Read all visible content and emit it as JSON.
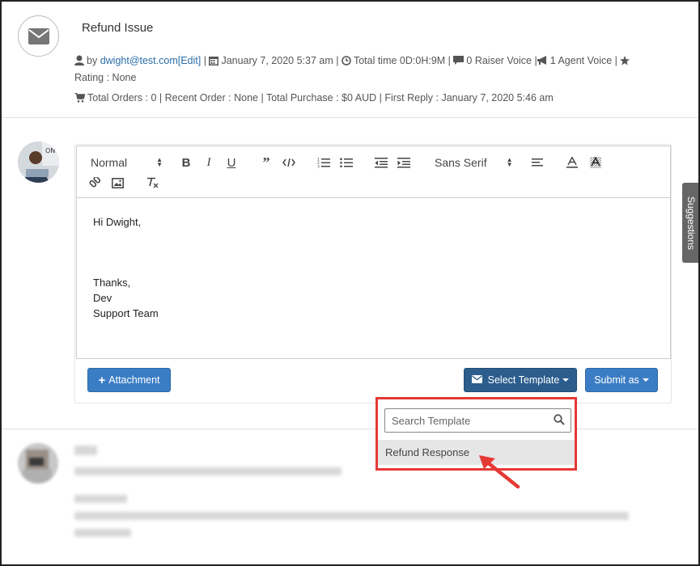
{
  "ticket": {
    "title": "Refund Issue",
    "by_prefix": "by",
    "author_email": "dwight@test.com",
    "edit_label": "[Edit]",
    "date": "January 7, 2020 5:37 am",
    "total_time": "Total time 0D:0H:9M",
    "raiser_voice": "0 Raiser Voice",
    "agent_voice": "1 Agent Voice",
    "rating": "Rating : None",
    "stats": "Total Orders : 0 | Recent Order : None | Total Purchase : $0 AUD | First Reply : January 7, 2020 5:46 am"
  },
  "toolbar": {
    "format_select": "Normal",
    "font_select": "Sans Serif"
  },
  "editor": {
    "line1": "Hi Dwight,",
    "line2": "Thanks,",
    "line3": "Dev",
    "line4": "Support Team"
  },
  "actions": {
    "attachment_label": "Attachment",
    "select_template_label": "Select Template",
    "submit_label": "Submit as"
  },
  "dropdown": {
    "search_placeholder": "Search Template",
    "items": [
      {
        "label": "Refund Response"
      }
    ]
  },
  "sidebar_tab": {
    "label": "Suggestions"
  },
  "colors": {
    "primary": "#3b7dc4",
    "primary_dark": "#2c5d8d",
    "highlight": "#e53935",
    "link": "#2a6eaa"
  }
}
